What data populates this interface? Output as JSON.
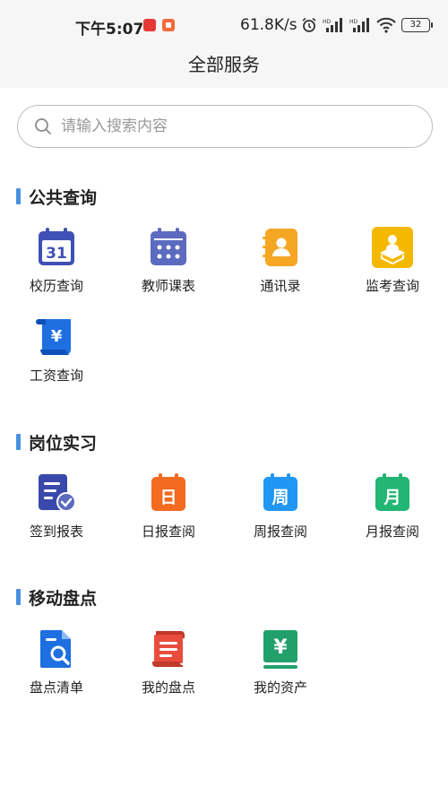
{
  "status": {
    "time": "下午5:07",
    "speed": "61.8K/s",
    "battery": "32"
  },
  "header": {
    "title": "全部服务"
  },
  "search": {
    "placeholder": "请输入搜索内容"
  },
  "sections": [
    {
      "title": "公共查询",
      "items": [
        {
          "label": "校历查询",
          "icon": "calendar-31-icon",
          "color": "#3f51b5"
        },
        {
          "label": "教师课表",
          "icon": "calendar-grid-icon",
          "color": "#5c6bc0"
        },
        {
          "label": "通讯录",
          "icon": "contacts-book-icon",
          "color": "#f5a623"
        },
        {
          "label": "监考查询",
          "icon": "exam-monitor-icon",
          "color": "#f5b800"
        },
        {
          "label": "工资查询",
          "icon": "salary-scroll-icon",
          "color": "#1e6fe0"
        }
      ]
    },
    {
      "title": "岗位实习",
      "items": [
        {
          "label": "签到报表",
          "icon": "checkin-report-icon",
          "color": "#3949ab"
        },
        {
          "label": "日报查阅",
          "icon": "daily-report-icon",
          "color": "#f36b21"
        },
        {
          "label": "周报查阅",
          "icon": "weekly-report-icon",
          "color": "#2196f3"
        },
        {
          "label": "月报查阅",
          "icon": "monthly-report-icon",
          "color": "#22b573"
        }
      ]
    },
    {
      "title": "移动盘点",
      "items": [
        {
          "label": "盘点清单",
          "icon": "inventory-list-icon",
          "color": "#1e6fe0"
        },
        {
          "label": "我的盘点",
          "icon": "my-inventory-icon",
          "color": "#e84c3d"
        },
        {
          "label": "我的资产",
          "icon": "my-assets-icon",
          "color": "#22a06b"
        }
      ]
    }
  ],
  "icon_glyphs": {
    "calendar_day": "31",
    "yen": "¥",
    "day": "日",
    "week": "周",
    "month": "月"
  }
}
